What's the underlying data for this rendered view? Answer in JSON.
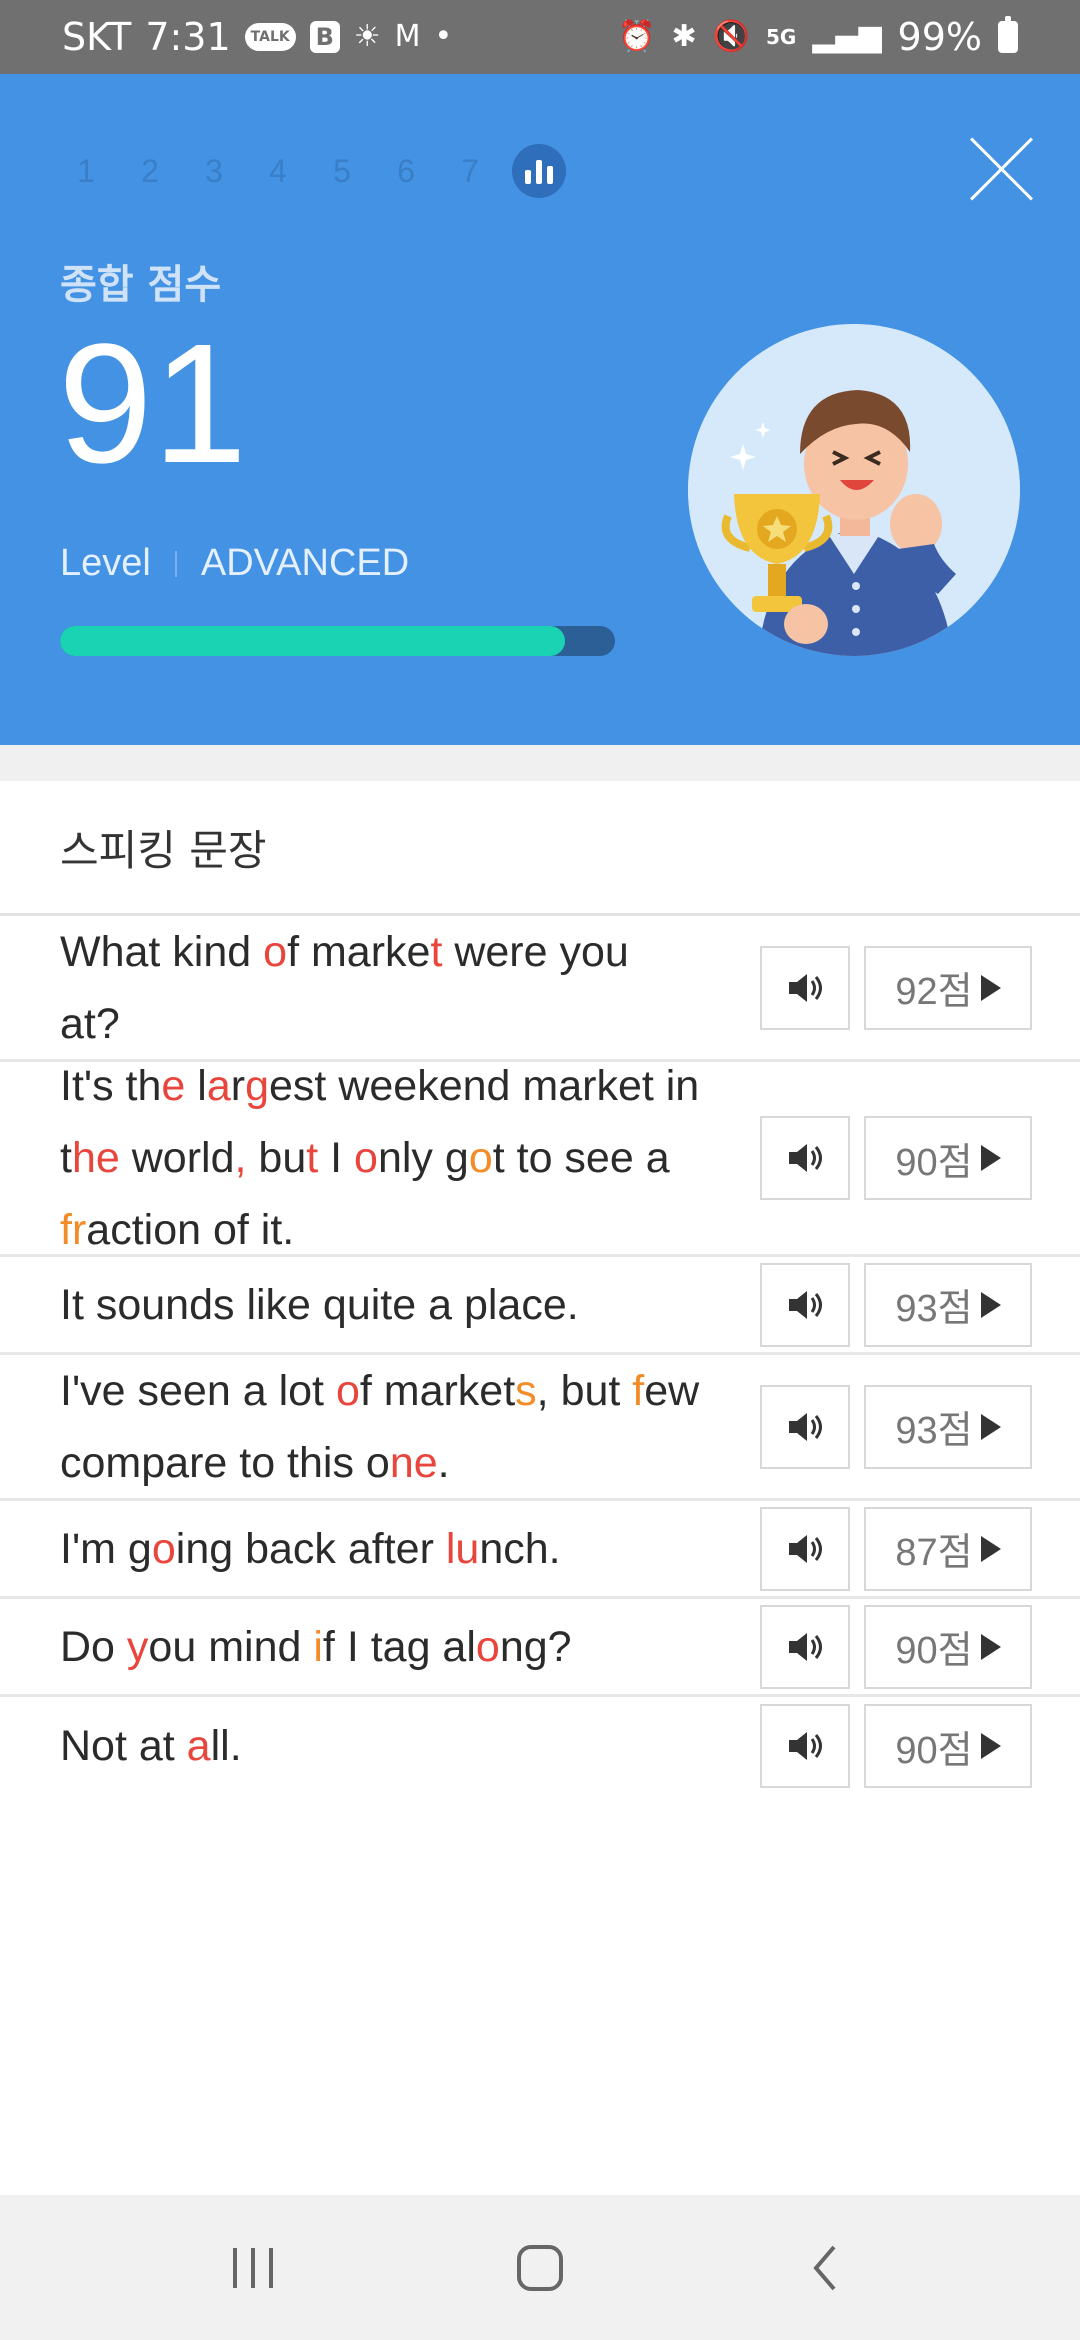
{
  "status_bar": {
    "carrier": "SKT",
    "time": "7:31",
    "talk_badge": "TALK",
    "b_badge": "B",
    "network": "5G",
    "battery": "99%"
  },
  "header": {
    "steps": [
      "1",
      "2",
      "3",
      "4",
      "5",
      "6",
      "7"
    ],
    "score_label": "종합 점수",
    "score": "91",
    "level_label": "Level",
    "level_value": "ADVANCED",
    "progress": 0.91,
    "colors": {
      "background": "#4392e3",
      "progress_fill": "#19d3b2",
      "progress_track": "#2d5f97"
    }
  },
  "section": {
    "title": "스피킹 문장"
  },
  "sentences": [
    {
      "text": "What kind of market were you at?",
      "score": "92점"
    },
    {
      "text": "It's the largest weekend market in the world, but I only got to see a fraction of it.",
      "score": "90점"
    },
    {
      "text": "It sounds like quite a place.",
      "score": "93점"
    },
    {
      "text": "I've seen a lot of markets, but few compare to this one.",
      "score": "93점"
    },
    {
      "text": "I'm going back after lunch.",
      "score": "87점"
    },
    {
      "text": "Do you mind if I tag along?",
      "score": "90점"
    },
    {
      "text": "Not at all.",
      "score": "90점"
    }
  ],
  "icons": {
    "sound": "speaker-icon",
    "play": "play-icon",
    "close": "close-icon",
    "result": "bar-chart-icon"
  },
  "highlight_colors": {
    "red": "#e8453c",
    "orange": "#f28c28"
  }
}
